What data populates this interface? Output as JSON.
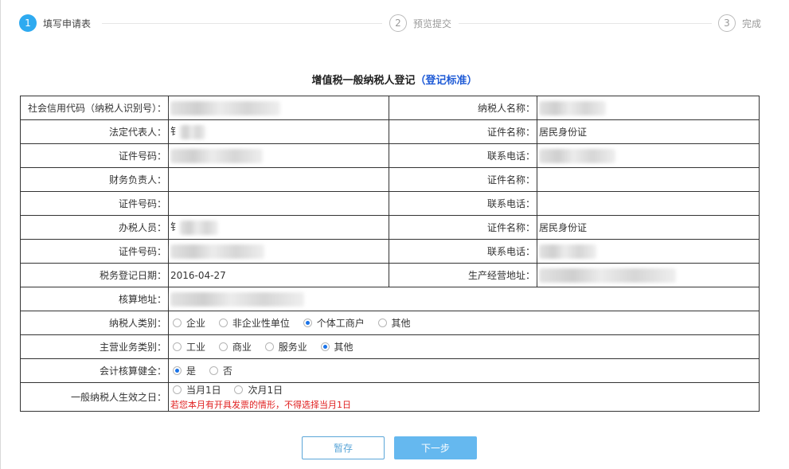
{
  "steps": [
    {
      "num": "1",
      "label": "填写申请表"
    },
    {
      "num": "2",
      "label": "预览提交"
    },
    {
      "num": "3",
      "label": "完成"
    }
  ],
  "title": {
    "text": "增值税一般纳税人登记",
    "paren_open": "（",
    "link": "登记标准",
    "paren_close": "）"
  },
  "form": {
    "credit_code_label": "社会信用代码（纳税人识别号）：",
    "taxpayer_name_label": "纳税人名称：",
    "legal_rep_label": "法定代表人：",
    "legal_rep_value": "钅",
    "cert_name_label": "证件名称：",
    "cert_name_value": "居民身份证",
    "cert_no_label": "证件号码：",
    "phone_label": "联系电话：",
    "finance_label": "财务负责人：",
    "agent_label": "办税人员：",
    "agent_value": "钅",
    "tax_reg_date_label": "税务登记日期：",
    "tax_reg_date_value": "2016-04-27",
    "business_address_label": "生产经营地址：",
    "accounting_address_label": "核算地址：",
    "taxpayer_type_label": "纳税人类别：",
    "taxpayer_type_options": [
      "企业",
      "非企业性单位",
      "个体工商户",
      "其他"
    ],
    "main_business_label": "主营业务类别：",
    "main_business_options": [
      "工业",
      "商业",
      "服务业",
      "其他"
    ],
    "accounting_sound_label": "会计核算健全：",
    "accounting_sound_options": [
      "是",
      "否"
    ],
    "effective_date_label": "一般纳税人生效之日：",
    "effective_date_options": [
      "当月1日",
      "次月1日"
    ],
    "warning": "若您本月有开具发票的情形，不得选择当月1日"
  },
  "buttons": {
    "save": "暂存",
    "next": "下一步"
  },
  "colors": {
    "accent": "#2eaaf0",
    "link": "#1f5bd6",
    "warning": "#e02020"
  }
}
